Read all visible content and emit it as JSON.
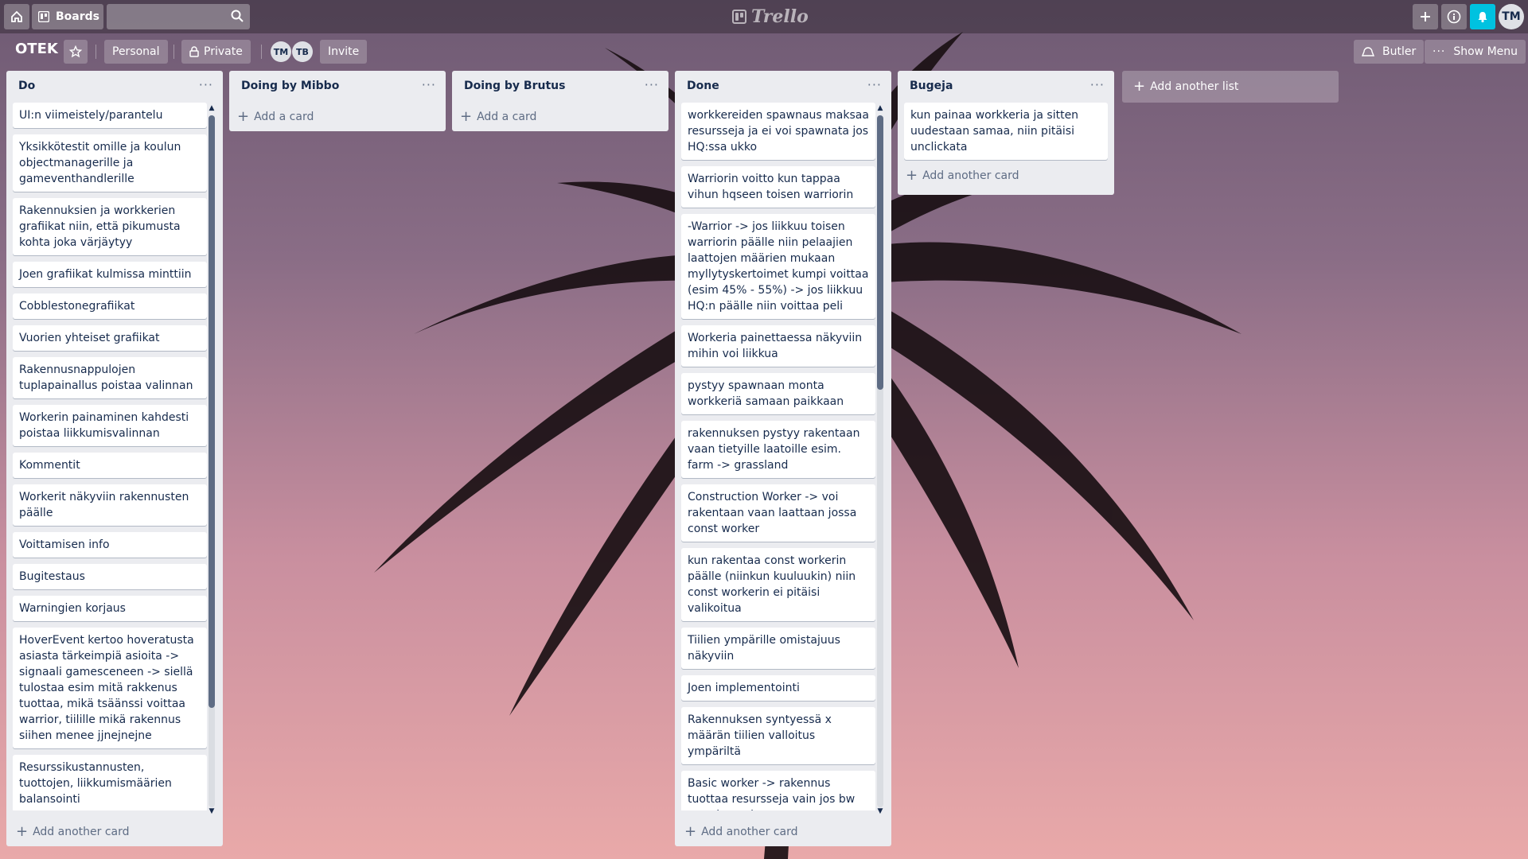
{
  "topbar": {
    "boards_label": "Boards",
    "search_placeholder": "",
    "logo_text": "Trello",
    "user_initials": "TM"
  },
  "board": {
    "title": "OTEK",
    "team_label": "Personal",
    "visibility_label": "Private",
    "members": [
      "TM",
      "TB"
    ],
    "invite_label": "Invite",
    "butler_label": "Butler",
    "show_menu_label": "Show Menu",
    "add_list_label": "Add another list"
  },
  "lists": [
    {
      "title": "Do",
      "add_label": "Add another card",
      "cards": [
        "UI:n viimeistely/parantelu",
        "Yksikkötestit omille ja koulun objectmanagerille ja gameventhandlerille",
        "Rakennuksien ja workkerien grafiikat niin, että pikumusta kohta joka värjäytyy",
        "Joen grafiikat kulmissa minttiin",
        "Cobblestonegrafiikat",
        "Vuorien yhteiset grafiikat",
        "Rakennusnappulojen tuplapainallus poistaa valinnan",
        "Workerin painaminen kahdesti poistaa liikkumisvalinnan",
        "Kommentit",
        "Workerit näkyviin rakennusten päälle",
        "Voittamisen info",
        "Bugitestaus",
        "Warningien korjaus",
        "HoverEvent kertoo hoveratusta asiasta tärkeimpiä asioita -> signaali gamesceneen -> siellä tulostaa esim mitä rakkenus tuottaa, mikä tsäänssi voittaa warrior, tiilille mikä rakennus siihen menee jjnejnejne",
        "Resurssikustannusten, tuottojen, liikkumismäärien balansointi"
      ]
    },
    {
      "title": "Doing by Mibbo",
      "add_label": "Add a card",
      "cards": []
    },
    {
      "title": "Doing by Brutus",
      "add_label": "Add a card",
      "cards": []
    },
    {
      "title": "Done",
      "add_label": "Add another card",
      "cards": [
        "workkereiden spawnaus maksaa resursseja ja ei voi spawnata jos HQ:ssa ukko",
        "Warriorin voitto kun tappaa vihun hqseen toisen warriorin",
        "-Warrior -> jos liikkuu toisen warriorin päälle niin pelaajien laattojen määrien mukaan myllytyskertoimet kumpi voittaa (esim 45% - 55%) -> jos liikkuu HQ:n päälle niin voittaa peli",
        "Workeria painettaessa näkyviin mihin voi liikkua",
        "pystyy spawnaan monta workkeriä samaan paikkaan",
        "rakennuksen pystyy rakentaan vaan tietyille laatoille esim. farm -> grassland",
        "Construction Worker -> voi rakentaan vaan laattaan jossa const worker",
        "kun rakentaa const workerin päälle (niinkun kuuluukin) niin const workerin ei pitäisi valikoitua",
        "Tiilien ympärille omistajuus näkyviin",
        "Joen implementointi",
        "Rakennuksen syntyessä x määrän tiilien valloitus ympäriltä",
        "Basic worker -> rakennus tuottaa resursseja vain jos bw on rakennuksessa"
      ]
    },
    {
      "title": "Bugeja",
      "add_label": "Add another card",
      "cards": [
        "kun painaa workkeria ja sitten uudestaan samaa, niin pitäisi unclickata"
      ]
    }
  ]
}
